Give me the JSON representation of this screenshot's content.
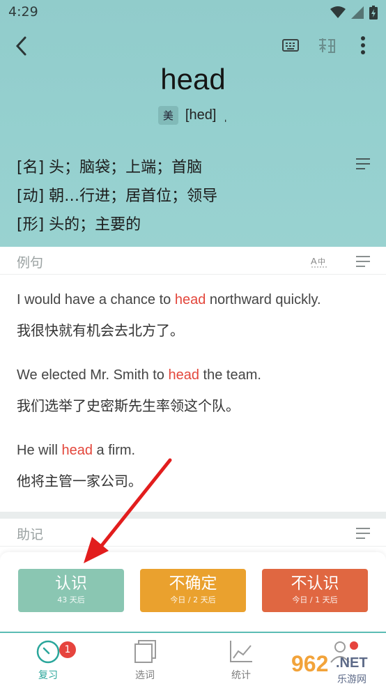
{
  "status": {
    "time": "4:29"
  },
  "word": {
    "text": "head",
    "accent": "美",
    "phonetic": "[hed]",
    "phonetic_mark": "ˌ"
  },
  "definitions": [
    "[名] 头；脑袋；上端；首脑",
    "[动] 朝…行进；居首位；领导",
    "[形] 头的；主要的"
  ],
  "examples": {
    "label": "例句",
    "items": [
      {
        "en_before": "I would have a chance to ",
        "en_word": "head",
        "en_after": " northward quickly.",
        "zh": "我很快就有机会去北方了。"
      },
      {
        "en_before": "We elected Mr. Smith to ",
        "en_word": "head",
        "en_after": " the team.",
        "zh": "我们选举了史密斯先生率领这个队。"
      },
      {
        "en_before": "He will ",
        "en_word": "head",
        "en_after": " a firm.",
        "zh": "他将主管一家公司。"
      }
    ]
  },
  "mnemonic": {
    "label": "助记"
  },
  "actions": [
    {
      "label": "认识",
      "sub": "43 天后",
      "color": "#8ac6b2"
    },
    {
      "label": "不确定",
      "sub": "今日 / 2 天后",
      "color": "#eaa12e"
    },
    {
      "label": "不认识",
      "sub": "今日 / 1 天后",
      "color": "#e06741"
    }
  ],
  "nav": [
    {
      "label": "复习",
      "badge": "1"
    },
    {
      "label": "选词"
    },
    {
      "label": "统计"
    }
  ],
  "watermark": {
    "number": "962",
    "suffix": ".NET",
    "site": "乐游网"
  },
  "colors": {
    "accent": "#2aa69b",
    "highlight": "#e3463b",
    "header": "#95d0cf"
  }
}
